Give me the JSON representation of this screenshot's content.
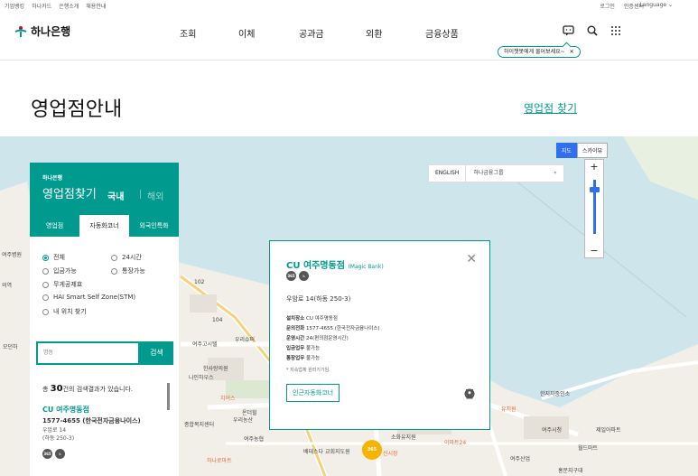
{
  "utility": {
    "left_links": [
      "기업뱅킹",
      "하나카드",
      "은행소개",
      "채용안내"
    ],
    "right_links": [
      "로그인",
      "인증센터"
    ],
    "language": "Language ⌄"
  },
  "header": {
    "logo_text": "하나은행",
    "nav": [
      "조회",
      "이체",
      "공과금",
      "외환",
      "금융상품"
    ],
    "chatbot_tooltip": "하이챗봇에게 물어보세요~",
    "tooltip_close": "✕"
  },
  "page": {
    "title": "영업점안내",
    "find_link": "영업점 찾기"
  },
  "map": {
    "toggle": [
      "지도",
      "스카이뷰"
    ],
    "zoom_plus": "+",
    "zoom_minus": "−",
    "lang_button": "ENGLISH",
    "group_select": "하나금융그룹",
    "labels": [
      "여주병원",
      "의역",
      "모던하",
      "104",
      "102",
      "여주고시텔",
      "한사랑의원",
      "나인하우스",
      "치어스",
      "온더힐",
      "우리농산",
      "종합복지센터",
      "여주농협",
      "소화유지원",
      "이마트24",
      "배데스다 교회지도원",
      "여주시청",
      "유치원",
      "여주산업",
      "한지차중인소",
      "홍문지구대",
      "하나로마트",
      "제일아파트",
      "월드마트",
      "365",
      "우리슈퍼",
      "신시장"
    ]
  },
  "finder": {
    "brand": "하나은행",
    "title": "영업점찾기",
    "domestic": "국내",
    "overseas": "해외",
    "tabs": [
      "영업점",
      "자동화코너",
      "외국인특화"
    ],
    "options": [
      "전체",
      "24시간",
      "입금가능",
      "통장가능",
      "무게공제효",
      "HAI Smart Self Zone(STM)",
      "내 위치 찾기"
    ],
    "search_value": "명동",
    "search_button": "검색",
    "result_prefix": "총 ",
    "result_count": "30",
    "result_suffix": "건의 검색결과가 있습니다.",
    "result": {
      "name": "CU 여주명동점",
      "phone": "1577-4655 (한국전자금융나이스)",
      "addr1": "우암로 14",
      "addr2": "(하동 250-3)",
      "icon_a": "365",
      "icon_b": "♿"
    }
  },
  "popup": {
    "name": "CU 여주명동점",
    "name_sub": "(Magic Bank)",
    "close": "✕",
    "addr": "우암로 14(하동 250-3)",
    "rows": [
      {
        "k": "설치장소",
        "v": "CU 여주명동점"
      },
      {
        "k": "문의전화",
        "v": "1577-4655 (한국전자금융나이스)"
      },
      {
        "k": "운영시간",
        "v": "24(편의점운영시간)"
      },
      {
        "k": "입금업무",
        "v": "불가능"
      },
      {
        "k": "통장업무",
        "v": "불가능"
      }
    ],
    "note": "* 지속업체 원리기기임.",
    "nearby_button": "인근자동화코너",
    "pin": "365"
  },
  "colors": {
    "brand": "#009b8e",
    "map_water": "#cfe5ec",
    "map_accent": "#2f6ff0",
    "pin": "#f5b400"
  }
}
